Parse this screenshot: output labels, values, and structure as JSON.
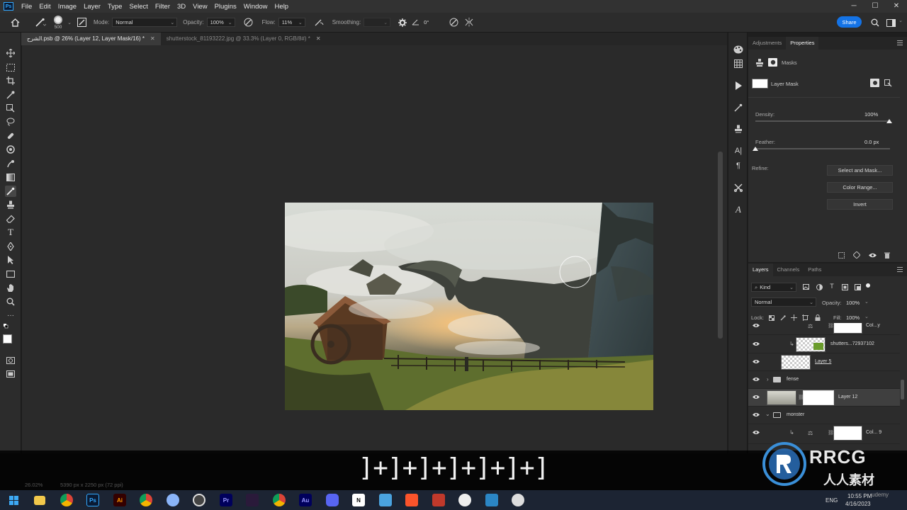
{
  "menubar": {
    "app_logo": "Ps",
    "items": [
      "File",
      "Edit",
      "Image",
      "Layer",
      "Type",
      "Select",
      "Filter",
      "3D",
      "View",
      "Plugins",
      "Window",
      "Help"
    ]
  },
  "options": {
    "brush_size": "500",
    "mode_label": "Mode:",
    "mode_value": "Normal",
    "opacity_label": "Opacity:",
    "opacity_value": "100%",
    "flow_label": "Flow:",
    "flow_value": "11%",
    "smoothing_label": "Smoothing:",
    "angle_value": "0°",
    "share_label": "Share"
  },
  "tabs": [
    {
      "label": "الشرح.psb @ 26% (Layer 12, Layer Mask/16) *",
      "active": true
    },
    {
      "label": "shutterstock_81193222.jpg @ 33.3% (Layer 0, RGB/8#) *",
      "active": false
    }
  ],
  "properties": {
    "tabs": [
      "Adjustments",
      "Properties"
    ],
    "section": "Masks",
    "mask_type": "Layer Mask",
    "density_label": "Density:",
    "density_value": "100%",
    "density_level": 1.0,
    "feather_label": "Feather:",
    "feather_value": "0.0 px",
    "feather_level": 0.0,
    "refine_label": "Refine:",
    "buttons": [
      "Select and Mask...",
      "Color Range...",
      "Invert"
    ]
  },
  "layers": {
    "tabs": [
      "Layers",
      "Channels",
      "Paths"
    ],
    "filter_label": "Kind",
    "blend_mode": "Normal",
    "opacity_label": "Opacity:",
    "opacity_value": "100%",
    "lock_label": "Lock:",
    "fill_label": "Fill:",
    "fill_value": "100%",
    "rows": [
      {
        "name": "Col...y",
        "type": "adjust"
      },
      {
        "name": "shutters...72937102",
        "type": "smart"
      },
      {
        "name": "Layer 5",
        "type": "pixel"
      },
      {
        "name": "fense",
        "type": "group"
      },
      {
        "name": "Layer 12",
        "type": "masked"
      },
      {
        "name": "monster",
        "type": "group"
      },
      {
        "name": "Col... 9",
        "type": "adjust"
      }
    ]
  },
  "status": {
    "zoom": "26.02%",
    "doc_size": "5390 px x 2250 px (72 ppi)"
  },
  "subtitle": "]+]+]+]+]+]+]",
  "taskbar": {
    "lang": "ENG",
    "time": "10:55 PM",
    "date": "4/16/2023"
  },
  "watermark": {
    "brand": "RRCG",
    "sub": "人人素材",
    "extra": "udemy"
  },
  "colors": {
    "accent": "#1473e6",
    "panel_bg": "#2c2c2c",
    "canvas_bg": "#2a2a2a"
  }
}
